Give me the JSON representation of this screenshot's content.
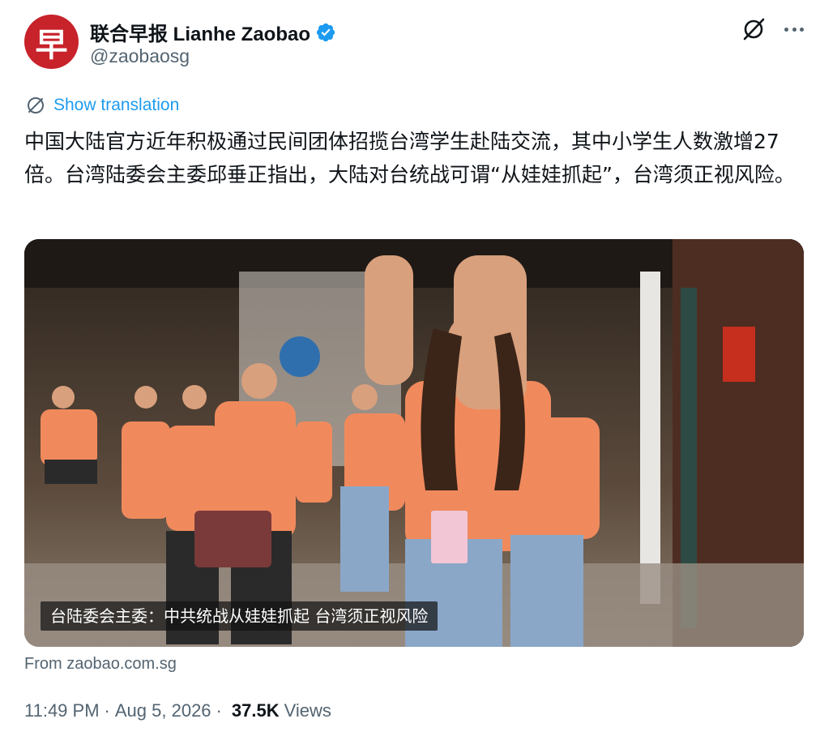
{
  "account": {
    "avatar_glyph": "早",
    "display_name": "联合早报 Lianhe Zaobao",
    "handle": "@zaobaosg",
    "verified": true
  },
  "translation": {
    "label": "Show translation"
  },
  "tweet": {
    "text": "中国大陆官方近年积极通过民间团体招揽台湾学生赴陆交流，其中小学生人数激增27倍。台湾陆委会主委邱垂正指出，大陆对台统战可谓“从娃娃抓起”，台湾须正视风险。"
  },
  "media": {
    "caption": "台陆委会主委：中共统战从娃娃抓起 台湾须正视风险"
  },
  "link_source": "From zaobao.com.sg",
  "meta": {
    "time": "11:49 PM",
    "separator": "·",
    "date": "Aug 5, 2026",
    "views_count": "37.5K",
    "views_label": "Views"
  },
  "colors": {
    "brand_red": "#c8222a",
    "link_blue": "#1d9bf0",
    "muted": "#536471",
    "shirt_orange": "#f08a5d"
  },
  "icons": [
    "verified-badge-icon",
    "grok-icon",
    "more-icon",
    "translate-icon"
  ]
}
